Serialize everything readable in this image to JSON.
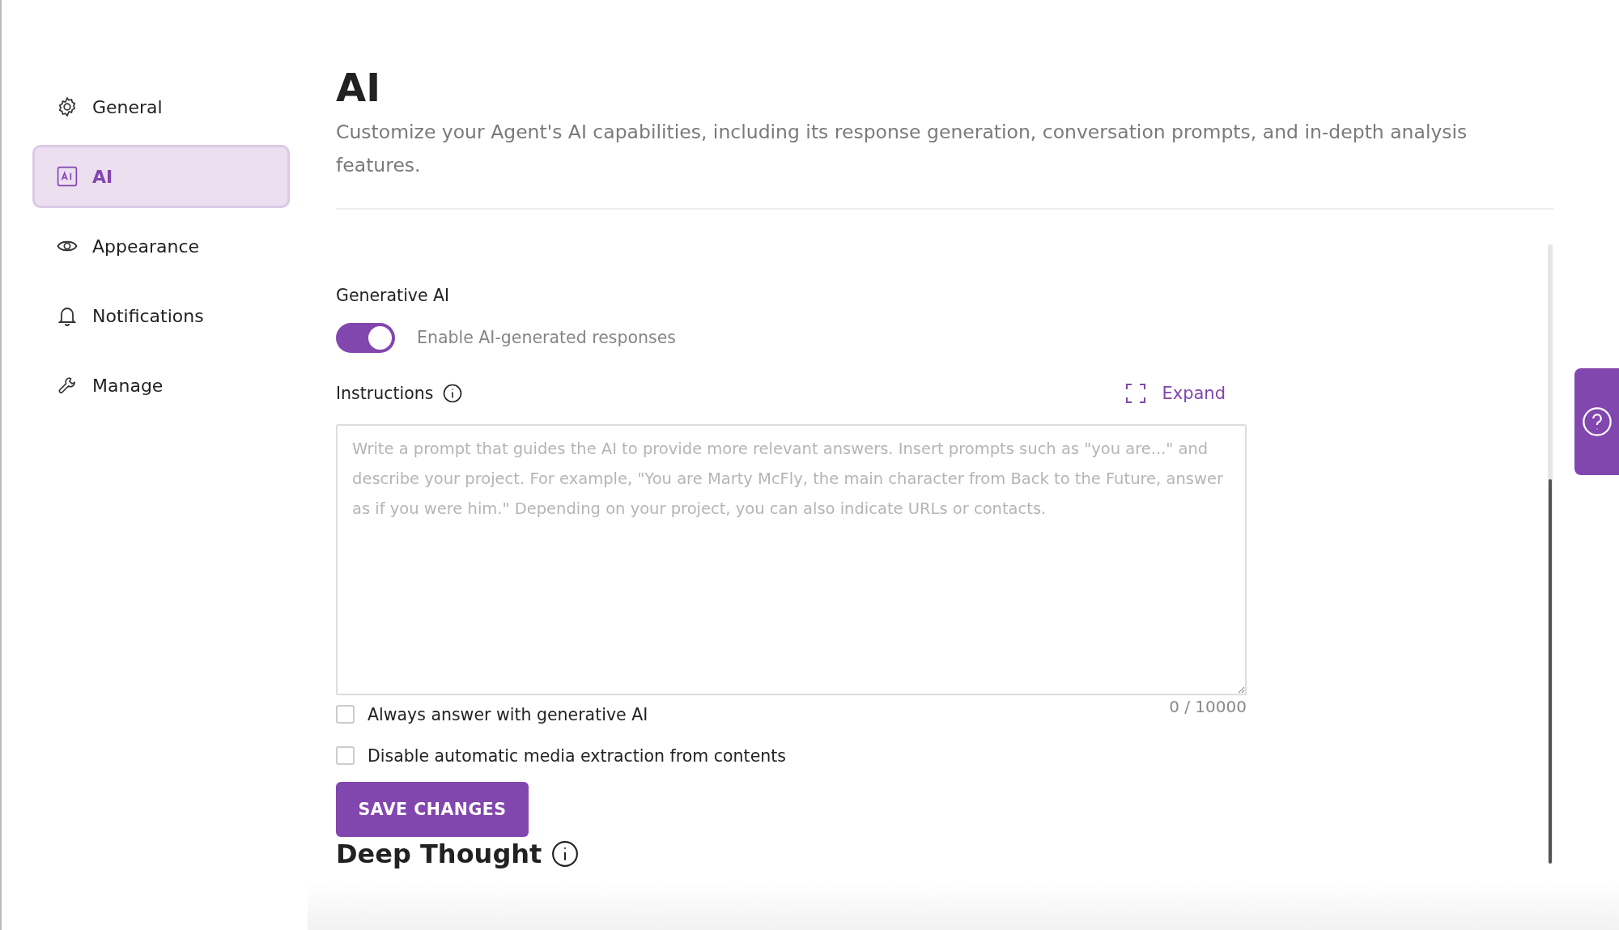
{
  "sidebar": {
    "items": [
      {
        "label": "General",
        "selected": false
      },
      {
        "label": "AI",
        "selected": true
      },
      {
        "label": "Appearance",
        "selected": false
      },
      {
        "label": "Notifications",
        "selected": false
      },
      {
        "label": "Manage",
        "selected": false
      }
    ]
  },
  "page": {
    "title": "AI",
    "description": "Customize your Agent's AI capabilities, including its response generation, conversation prompts, and in-depth analysis features."
  },
  "generative_ai": {
    "label": "Generative AI",
    "toggle": {
      "label": "Enable AI-generated responses",
      "on": true
    },
    "instructions": {
      "label": "Instructions",
      "expand": "Expand",
      "placeholder": "Write a prompt that guides the AI to provide more relevant answers. Insert prompts such as \"you are...\" and describe your project. For example, \"You are Marty McFly, the main character from Back to the Future, answer as if you were him.\" Depending on your project, you can also indicate URLs or contacts.",
      "counter": "0 / 10000"
    },
    "checkboxes": [
      {
        "label": "Always answer with generative AI",
        "checked": false
      },
      {
        "label": "Disable automatic media extraction from contents",
        "checked": false
      }
    ],
    "save_button": "SAVE CHANGES"
  },
  "deep_thought": {
    "title": "Deep Thought"
  }
}
